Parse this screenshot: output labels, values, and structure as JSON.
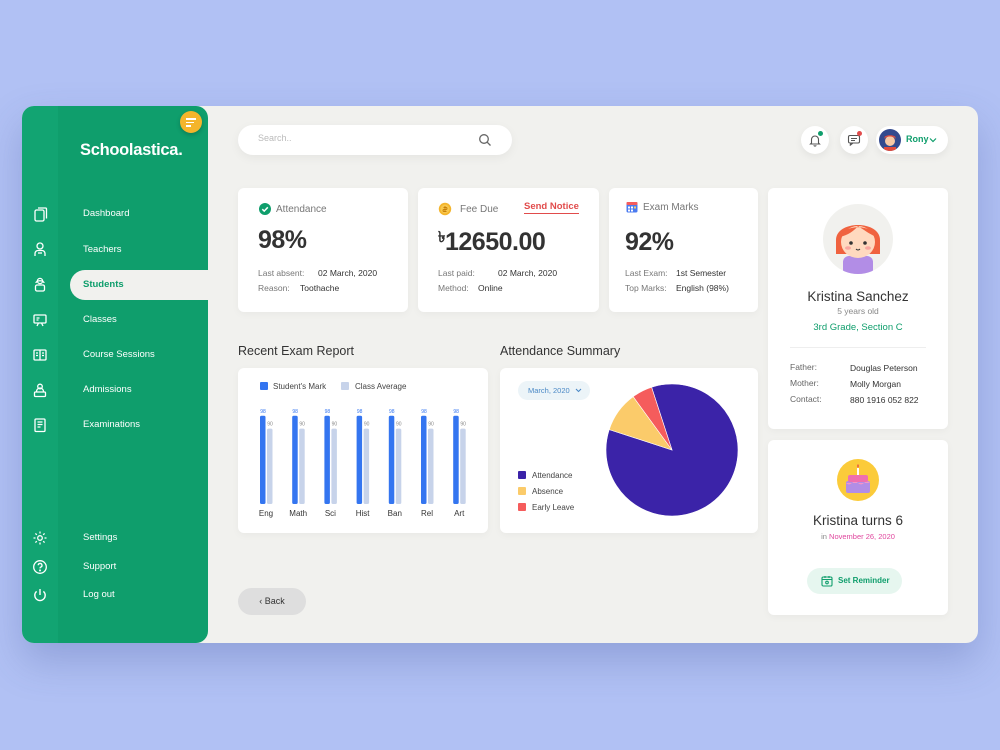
{
  "app": {
    "name": "Schoolastica."
  },
  "sidebar": {
    "items": [
      {
        "label": "Dashboard"
      },
      {
        "label": "Teachers"
      },
      {
        "label": "Students"
      },
      {
        "label": "Classes"
      },
      {
        "label": "Course Sessions"
      },
      {
        "label": "Admissions"
      },
      {
        "label": "Examinations"
      }
    ],
    "bottom_items": [
      {
        "label": "Settings"
      },
      {
        "label": "Support"
      },
      {
        "label": "Log out"
      }
    ],
    "active": "Students"
  },
  "search": {
    "placeholder": "Search.."
  },
  "user": {
    "name": "Rony"
  },
  "stats": {
    "attendance": {
      "label": "Attendance",
      "value": "98%",
      "k1": "Last absent:",
      "v1": "02 March, 2020",
      "k2": "Reason:",
      "v2": "Toothache"
    },
    "fee": {
      "label": "Fee Due",
      "action": "Send Notice",
      "currency": "৳",
      "value": "12650.00",
      "k1": "Last paid:",
      "v1": "02 March, 2020",
      "k2": "Method:",
      "v2": "Online"
    },
    "exam": {
      "label": "Exam Marks",
      "value": "92%",
      "k1": "Last Exam:",
      "v1": "1st Semester",
      "k2": "Top Marks:",
      "v2": "English (98%)"
    }
  },
  "exam_report": {
    "title": "Recent Exam Report",
    "legend": [
      "Student's Mark",
      "Class Average"
    ]
  },
  "attendance_summary": {
    "title": "Attendance Summary",
    "month": "March, 2020",
    "legend": [
      "Attendance",
      "Absence",
      "Early Leave"
    ]
  },
  "chart_data": [
    {
      "type": "bar",
      "title": "Recent Exam Report",
      "categories": [
        "Eng",
        "Math",
        "Sci",
        "Hist",
        "Ban",
        "Rel",
        "Art"
      ],
      "series": [
        {
          "name": "Student's Mark",
          "values": [
            98,
            98,
            98,
            98,
            98,
            98,
            98
          ],
          "color": "#3475f0"
        },
        {
          "name": "Class Average",
          "values": [
            90,
            90,
            90,
            90,
            90,
            90,
            90
          ],
          "color": "#c7d3ea"
        }
      ],
      "ylim": [
        0,
        100
      ]
    },
    {
      "type": "pie",
      "title": "Attendance Summary",
      "labels": [
        "Attendance",
        "Absence",
        "Early Leave"
      ],
      "values": [
        85,
        10,
        5
      ],
      "colors": [
        "#3b23a8",
        "#fbcb6a",
        "#f55c5c"
      ]
    }
  ],
  "profile": {
    "name": "Kristina Sanchez",
    "age": "5 years old",
    "grade": "3rd Grade, Section C",
    "fields": [
      {
        "label": "Father:",
        "value": "Douglas Peterson"
      },
      {
        "label": "Mother:",
        "value": "Molly Morgan"
      },
      {
        "label": "Contact:",
        "value": "880 1916 052 822"
      }
    ]
  },
  "birthday": {
    "title": "Kristina turns 6",
    "prefix": "in",
    "date": "November 26, 2020",
    "action": "Set Reminder"
  },
  "nav": {
    "back_label": "Back"
  },
  "colors": {
    "brand": "#0f9e6c",
    "accent": "#f4b52c",
    "alert": "#e14b4b",
    "pink": "#e0479e"
  }
}
